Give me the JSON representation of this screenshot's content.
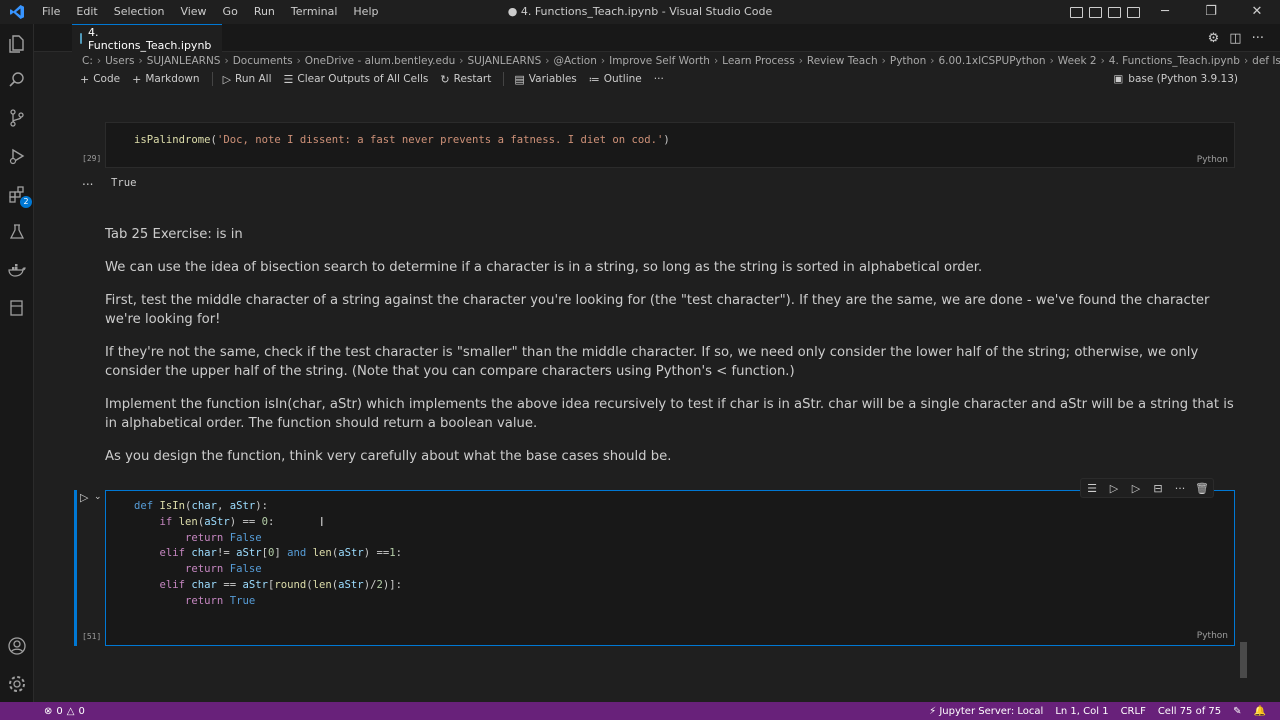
{
  "window": {
    "title": "● 4. Functions_Teach.ipynb - Visual Studio Code",
    "menu": [
      "File",
      "Edit",
      "Selection",
      "View",
      "Go",
      "Run",
      "Terminal",
      "Help"
    ]
  },
  "tab": {
    "label": "4. Functions_Teach.ipynb"
  },
  "breadcrumbs": [
    "C:",
    "Users",
    "SUJANLEARNS",
    "Documents",
    "OneDrive - alum.bentley.edu",
    "SUJANLEARNS",
    "@Action",
    "Improve Self Worth",
    "Learn Process",
    "Review Teach",
    "Python",
    "6.00.1xICSPUPython",
    "Week 2",
    "4. Functions_Teach.ipynb",
    "def IsIn(char, aStr):"
  ],
  "toolbar": {
    "code": "Code",
    "markdown": "Markdown",
    "run_all": "Run All",
    "clear_outputs": "Clear Outputs of All Cells",
    "restart": "Restart",
    "variables": "Variables",
    "outline": "Outline",
    "more": "···",
    "kernel": "base (Python 3.9.13)"
  },
  "cells": {
    "prev_code": {
      "exec_count": "[29]",
      "language": "Python",
      "fn": "isPalindrome",
      "arg": "'Doc, note I dissent: a fast never prevents a fatness. I diet on cod.'"
    },
    "prev_output": {
      "ellipsis": "...",
      "text": "True"
    },
    "markdown": {
      "heading": "Tab 25 Exercise: is in",
      "p1": "We can use the idea of bisection search to determine if a character is in a string, so long as the string is sorted in alphabetical order.",
      "p2": "First, test the middle character of a string against the character you're looking for (the \"test character\"). If they are the same, we are done - we've found the character we're looking for!",
      "p3": "If they're not the same, check if the test character is \"smaller\" than the middle character. If so, we need only consider the lower half of the string; otherwise, we only consider the upper half of the string. (Note that you can compare characters using Python's < function.)",
      "p4": "Implement the function isIn(char, aStr) which implements the above idea recursively to test if char is in aStr. char will be a single character and aStr will be a string that is in alphabetical order. The function should return a boolean value.",
      "p5": "As you design the function, think very carefully about what the base cases should be."
    },
    "active_code": {
      "exec_count": "[51]",
      "language": "Python"
    }
  },
  "status": {
    "errors": "0",
    "warnings": "0",
    "jupyter": "Jupyter Server: Local",
    "position": "Ln 1, Col 1",
    "eol": "CRLF",
    "cell": "Cell 75 of 75"
  },
  "colors": {
    "statusbar": "#68217a",
    "accent": "#0078d4",
    "keyword": "#569cd6",
    "control": "#c586c0",
    "function": "#dcdcaa",
    "string": "#ce9178",
    "number": "#b5cea8",
    "variable": "#9cdcfe"
  }
}
